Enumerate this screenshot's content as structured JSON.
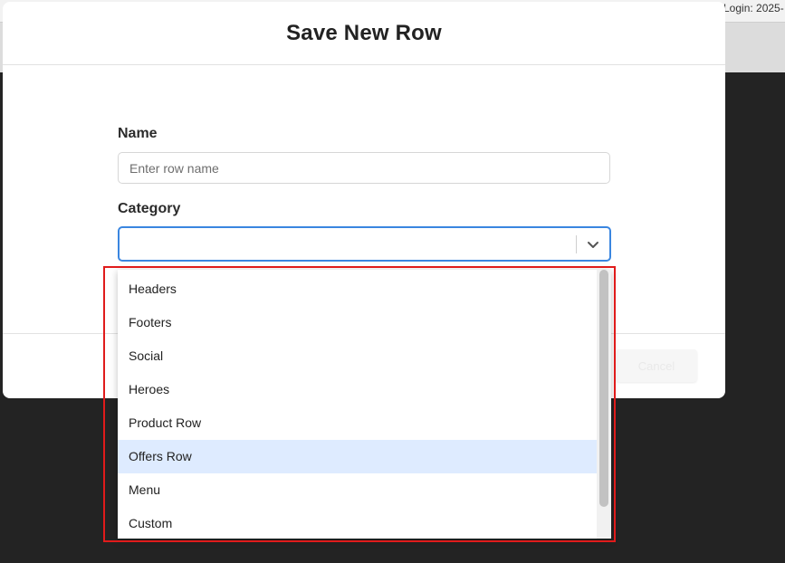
{
  "background": {
    "login_text": "Login: 2025-"
  },
  "modal": {
    "title": "Save New Row",
    "name_label": "Name",
    "name_placeholder": "Enter row name",
    "name_value": "",
    "category_label": "Category",
    "category_value": "",
    "cancel_label": "Cancel"
  },
  "dropdown": {
    "options": [
      {
        "label": "Headers"
      },
      {
        "label": "Footers"
      },
      {
        "label": "Social"
      },
      {
        "label": "Heroes"
      },
      {
        "label": "Product Row"
      },
      {
        "label": "Offers Row"
      },
      {
        "label": "Menu"
      },
      {
        "label": "Custom"
      }
    ],
    "highlighted_option": "Offers Row"
  },
  "colors": {
    "focus_border": "#3a86e0",
    "highlight_row": "#deebff",
    "annotation_frame": "#e01b1b"
  },
  "icons": {
    "select_chevron": "chevron-down-icon"
  }
}
